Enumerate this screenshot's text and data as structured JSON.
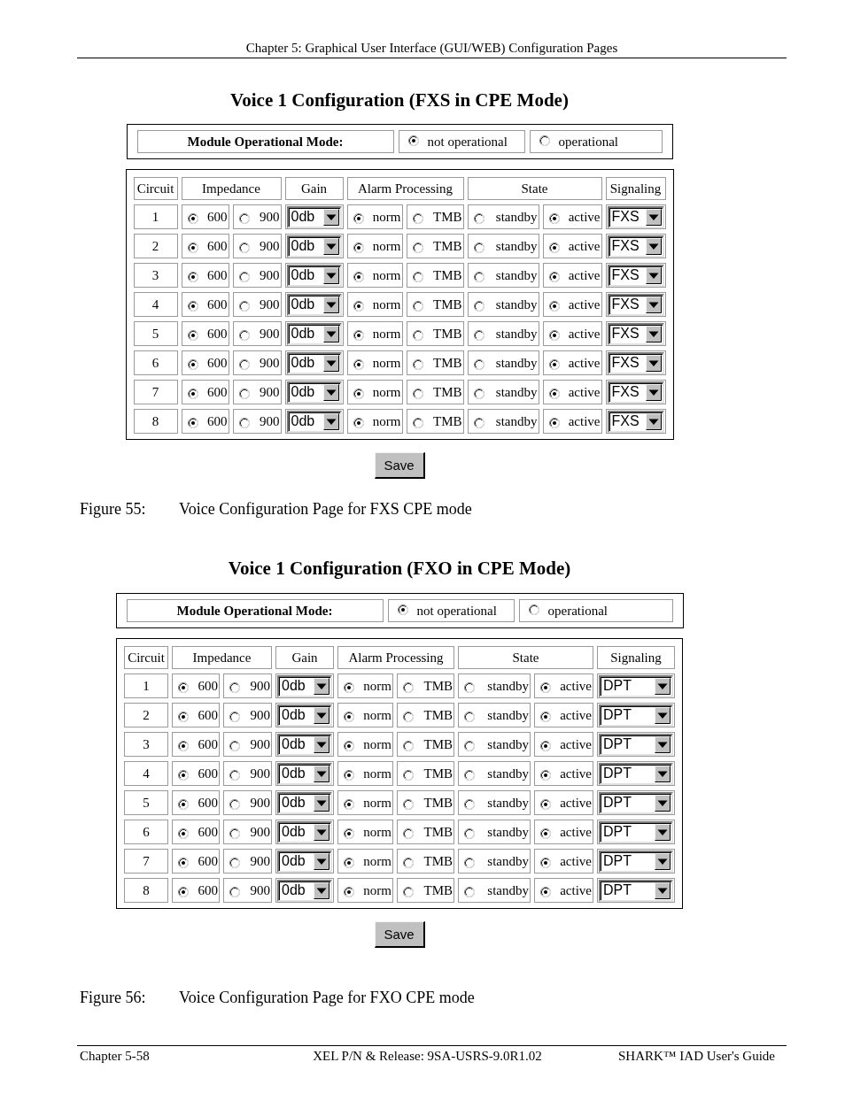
{
  "header": {
    "title": "Chapter 5: Graphical User Interface (GUI/WEB) Configuration Pages"
  },
  "sections": [
    {
      "title": "Voice 1 Configuration (FXS in CPE Mode)",
      "mode": {
        "label": "Module Operational Mode:",
        "options": [
          {
            "label": "not operational",
            "selected": true
          },
          {
            "label": "operational",
            "selected": false
          }
        ]
      },
      "columns": [
        "Circuit",
        "Impedance",
        "Gain",
        "Alarm Processing",
        "State",
        "Signaling"
      ],
      "rows": [
        {
          "circuit": "1",
          "impedance": [
            {
              "label": "600",
              "selected": true
            },
            {
              "label": "900",
              "selected": false
            }
          ],
          "gain": "0db",
          "alarm_processing": [
            {
              "label": "norm",
              "selected": true
            },
            {
              "label": "TMB",
              "selected": false
            }
          ],
          "state": [
            {
              "label": "standby",
              "selected": false
            },
            {
              "label": "active",
              "selected": true
            }
          ],
          "signaling": "FXS"
        },
        {
          "circuit": "2",
          "impedance": [
            {
              "label": "600",
              "selected": true
            },
            {
              "label": "900",
              "selected": false
            }
          ],
          "gain": "0db",
          "alarm_processing": [
            {
              "label": "norm",
              "selected": true
            },
            {
              "label": "TMB",
              "selected": false
            }
          ],
          "state": [
            {
              "label": "standby",
              "selected": false
            },
            {
              "label": "active",
              "selected": true
            }
          ],
          "signaling": "FXS"
        },
        {
          "circuit": "3",
          "impedance": [
            {
              "label": "600",
              "selected": true
            },
            {
              "label": "900",
              "selected": false
            }
          ],
          "gain": "0db",
          "alarm_processing": [
            {
              "label": "norm",
              "selected": true
            },
            {
              "label": "TMB",
              "selected": false
            }
          ],
          "state": [
            {
              "label": "standby",
              "selected": false
            },
            {
              "label": "active",
              "selected": true
            }
          ],
          "signaling": "FXS"
        },
        {
          "circuit": "4",
          "impedance": [
            {
              "label": "600",
              "selected": true
            },
            {
              "label": "900",
              "selected": false
            }
          ],
          "gain": "0db",
          "alarm_processing": [
            {
              "label": "norm",
              "selected": true
            },
            {
              "label": "TMB",
              "selected": false
            }
          ],
          "state": [
            {
              "label": "standby",
              "selected": false
            },
            {
              "label": "active",
              "selected": true
            }
          ],
          "signaling": "FXS"
        },
        {
          "circuit": "5",
          "impedance": [
            {
              "label": "600",
              "selected": true
            },
            {
              "label": "900",
              "selected": false
            }
          ],
          "gain": "0db",
          "alarm_processing": [
            {
              "label": "norm",
              "selected": true
            },
            {
              "label": "TMB",
              "selected": false
            }
          ],
          "state": [
            {
              "label": "standby",
              "selected": false
            },
            {
              "label": "active",
              "selected": true
            }
          ],
          "signaling": "FXS"
        },
        {
          "circuit": "6",
          "impedance": [
            {
              "label": "600",
              "selected": true
            },
            {
              "label": "900",
              "selected": false
            }
          ],
          "gain": "0db",
          "alarm_processing": [
            {
              "label": "norm",
              "selected": true
            },
            {
              "label": "TMB",
              "selected": false
            }
          ],
          "state": [
            {
              "label": "standby",
              "selected": false
            },
            {
              "label": "active",
              "selected": true
            }
          ],
          "signaling": "FXS"
        },
        {
          "circuit": "7",
          "impedance": [
            {
              "label": "600",
              "selected": true
            },
            {
              "label": "900",
              "selected": false
            }
          ],
          "gain": "0db",
          "alarm_processing": [
            {
              "label": "norm",
              "selected": true
            },
            {
              "label": "TMB",
              "selected": false
            }
          ],
          "state": [
            {
              "label": "standby",
              "selected": false
            },
            {
              "label": "active",
              "selected": true
            }
          ],
          "signaling": "FXS"
        },
        {
          "circuit": "8",
          "impedance": [
            {
              "label": "600",
              "selected": true
            },
            {
              "label": "900",
              "selected": false
            }
          ],
          "gain": "0db",
          "alarm_processing": [
            {
              "label": "norm",
              "selected": true
            },
            {
              "label": "TMB",
              "selected": false
            }
          ],
          "state": [
            {
              "label": "standby",
              "selected": false
            },
            {
              "label": "active",
              "selected": true
            }
          ],
          "signaling": "FXS"
        }
      ],
      "save_button": "Save",
      "caption": {
        "number": "Figure 55:",
        "text": "Voice Configuration Page for FXS CPE mode"
      }
    },
    {
      "title": "Voice 1 Configuration (FXO in CPE Mode)",
      "mode": {
        "label": "Module Operational Mode:",
        "options": [
          {
            "label": "not operational",
            "selected": true
          },
          {
            "label": "operational",
            "selected": false
          }
        ]
      },
      "columns": [
        "Circuit",
        "Impedance",
        "Gain",
        "Alarm Processing",
        "State",
        "Signaling"
      ],
      "rows": [
        {
          "circuit": "1",
          "impedance": [
            {
              "label": "600",
              "selected": true
            },
            {
              "label": "900",
              "selected": false
            }
          ],
          "gain": "0db",
          "alarm_processing": [
            {
              "label": "norm",
              "selected": true
            },
            {
              "label": "TMB",
              "selected": false
            }
          ],
          "state": [
            {
              "label": "standby",
              "selected": false
            },
            {
              "label": "active",
              "selected": true
            }
          ],
          "signaling": "DPT"
        },
        {
          "circuit": "2",
          "impedance": [
            {
              "label": "600",
              "selected": true
            },
            {
              "label": "900",
              "selected": false
            }
          ],
          "gain": "0db",
          "alarm_processing": [
            {
              "label": "norm",
              "selected": true
            },
            {
              "label": "TMB",
              "selected": false
            }
          ],
          "state": [
            {
              "label": "standby",
              "selected": false
            },
            {
              "label": "active",
              "selected": true
            }
          ],
          "signaling": "DPT"
        },
        {
          "circuit": "3",
          "impedance": [
            {
              "label": "600",
              "selected": true
            },
            {
              "label": "900",
              "selected": false
            }
          ],
          "gain": "0db",
          "alarm_processing": [
            {
              "label": "norm",
              "selected": true
            },
            {
              "label": "TMB",
              "selected": false
            }
          ],
          "state": [
            {
              "label": "standby",
              "selected": false
            },
            {
              "label": "active",
              "selected": true
            }
          ],
          "signaling": "DPT"
        },
        {
          "circuit": "4",
          "impedance": [
            {
              "label": "600",
              "selected": true
            },
            {
              "label": "900",
              "selected": false
            }
          ],
          "gain": "0db",
          "alarm_processing": [
            {
              "label": "norm",
              "selected": true
            },
            {
              "label": "TMB",
              "selected": false
            }
          ],
          "state": [
            {
              "label": "standby",
              "selected": false
            },
            {
              "label": "active",
              "selected": true
            }
          ],
          "signaling": "DPT"
        },
        {
          "circuit": "5",
          "impedance": [
            {
              "label": "600",
              "selected": true
            },
            {
              "label": "900",
              "selected": false
            }
          ],
          "gain": "0db",
          "alarm_processing": [
            {
              "label": "norm",
              "selected": true
            },
            {
              "label": "TMB",
              "selected": false
            }
          ],
          "state": [
            {
              "label": "standby",
              "selected": false
            },
            {
              "label": "active",
              "selected": true
            }
          ],
          "signaling": "DPT"
        },
        {
          "circuit": "6",
          "impedance": [
            {
              "label": "600",
              "selected": true
            },
            {
              "label": "900",
              "selected": false
            }
          ],
          "gain": "0db",
          "alarm_processing": [
            {
              "label": "norm",
              "selected": true
            },
            {
              "label": "TMB",
              "selected": false
            }
          ],
          "state": [
            {
              "label": "standby",
              "selected": false
            },
            {
              "label": "active",
              "selected": true
            }
          ],
          "signaling": "DPT"
        },
        {
          "circuit": "7",
          "impedance": [
            {
              "label": "600",
              "selected": true
            },
            {
              "label": "900",
              "selected": false
            }
          ],
          "gain": "0db",
          "alarm_processing": [
            {
              "label": "norm",
              "selected": true
            },
            {
              "label": "TMB",
              "selected": false
            }
          ],
          "state": [
            {
              "label": "standby",
              "selected": false
            },
            {
              "label": "active",
              "selected": true
            }
          ],
          "signaling": "DPT"
        },
        {
          "circuit": "8",
          "impedance": [
            {
              "label": "600",
              "selected": true
            },
            {
              "label": "900",
              "selected": false
            }
          ],
          "gain": "0db",
          "alarm_processing": [
            {
              "label": "norm",
              "selected": true
            },
            {
              "label": "TMB",
              "selected": false
            }
          ],
          "state": [
            {
              "label": "standby",
              "selected": false
            },
            {
              "label": "active",
              "selected": true
            }
          ],
          "signaling": "DPT"
        }
      ],
      "save_button": "Save",
      "caption": {
        "number": "Figure 56:",
        "text": "Voice Configuration Page for FXO CPE mode"
      }
    }
  ],
  "footer": {
    "chapter": "Chapter 5-58",
    "release": "XEL P/N & Release: 9SA-USRS-9.0R1.02",
    "guide": "SHARK™ IAD User's Guide"
  }
}
